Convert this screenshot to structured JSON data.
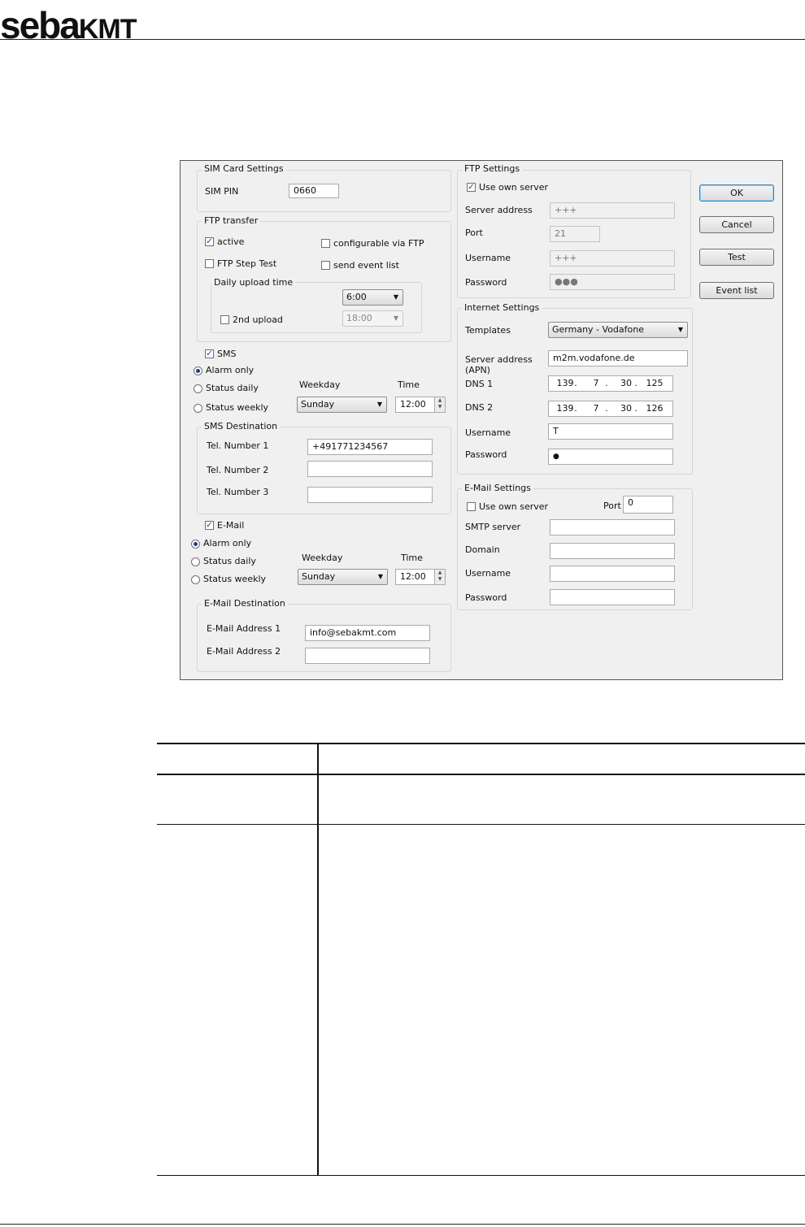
{
  "header": {
    "logo_part1": "seba",
    "logo_part2": "KMT"
  },
  "dialog": {
    "sim": {
      "title": "SIM Card Settings",
      "pin_label": "SIM PIN",
      "pin_value": "0660"
    },
    "ftp_transfer": {
      "title": "FTP transfer",
      "active_label": "active",
      "active_checked": "✓",
      "configurable_label": "configurable via FTP",
      "step_test_label": "FTP Step Test",
      "send_event_list_label": "send event list",
      "daily_title": "Daily upload time",
      "upload_time": "6:00",
      "second_upload_label": "2nd upload",
      "second_upload_time": "18:00"
    },
    "sms": {
      "label": "SMS",
      "checked": "✓",
      "alarm_only": "Alarm only",
      "status_daily": "Status daily",
      "status_weekly": "Status weekly",
      "weekday_label": "Weekday",
      "time_label": "Time",
      "weekday_value": "Sunday",
      "time_value": "12:00"
    },
    "sms_destination": {
      "title": "SMS Destination",
      "tel1_label": "Tel. Number 1",
      "tel1_value": "+491771234567",
      "tel2_label": "Tel. Number 2",
      "tel2_value": "",
      "tel3_label": "Tel. Number 3",
      "tel3_value": ""
    },
    "email": {
      "label": "E-Mail",
      "checked": "✓",
      "alarm_only": "Alarm only",
      "status_daily": "Status daily",
      "status_weekly": "Status weekly",
      "weekday_label": "Weekday",
      "time_label": "Time",
      "weekday_value": "Sunday",
      "time_value": "12:00"
    },
    "email_destination": {
      "title": "E-Mail Destination",
      "addr1_label": "E-Mail Address 1",
      "addr1_value": "info@sebakmt.com",
      "addr2_label": "E-Mail Address 2",
      "addr2_value": ""
    },
    "ftp_settings": {
      "title": "FTP Settings",
      "use_own_label": "Use own server",
      "use_own_checked": "✓",
      "server_label": "Server address",
      "server_value": "+++",
      "port_label": "Port",
      "port_value": "21",
      "username_label": "Username",
      "username_value": "+++",
      "password_label": "Password",
      "password_value": "●●●"
    },
    "internet": {
      "title": "Internet Settings",
      "templates_label": "Templates",
      "templates_value": "Germany - Vodafone",
      "server_label_1": "Server address",
      "server_label_2": "(APN)",
      "server_value": "m2m.vodafone.de",
      "dns1_label": "DNS 1",
      "dns1": [
        "139",
        "7",
        "30",
        "125"
      ],
      "dns2_label": "DNS 2",
      "dns2": [
        "139",
        "7",
        "30",
        "126"
      ],
      "dot": ".",
      "username_label": "Username",
      "username_value": "T",
      "password_label": "Password",
      "password_value": "●"
    },
    "email_settings": {
      "title": "E-Mail Settings",
      "use_own_label": "Use own server",
      "port_label": "Port",
      "port_value": "0",
      "smtp_label": "SMTP server",
      "domain_label": "Domain",
      "username_label": "Username",
      "password_label": "Password"
    },
    "buttons": {
      "ok": "OK",
      "cancel": "Cancel",
      "test": "Test",
      "event_list": "Event list"
    },
    "arrow_down": "▼",
    "spin_up": "▲",
    "spin_down": "▼"
  }
}
